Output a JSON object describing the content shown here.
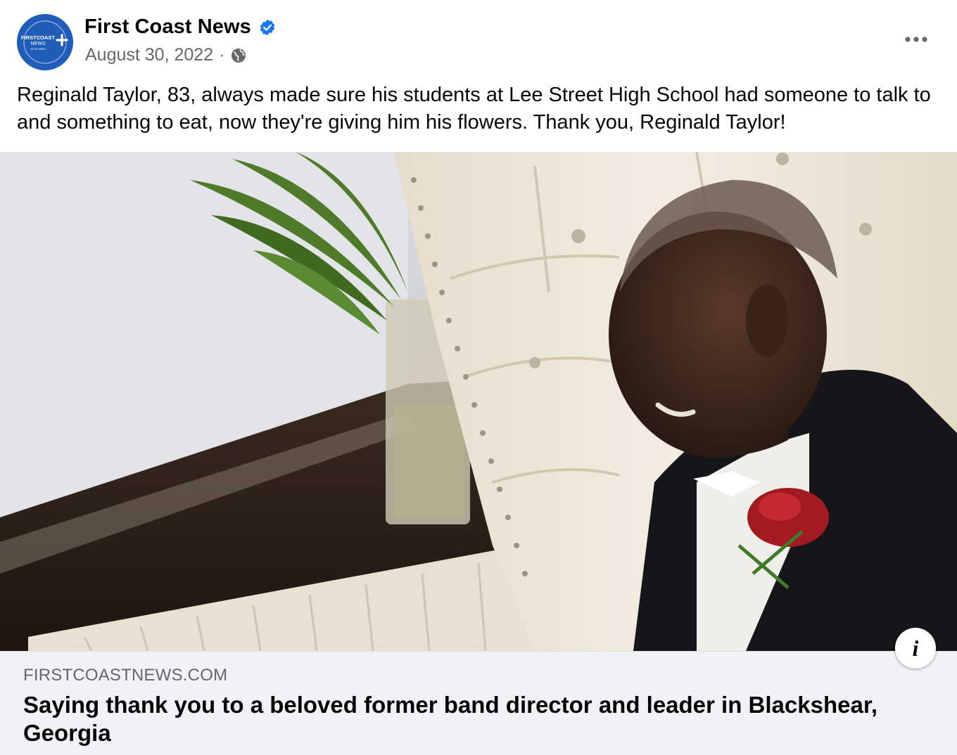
{
  "post": {
    "page_name": "First Coast News",
    "verified": true,
    "date": "August 30, 2022",
    "separator": "·",
    "privacy_icon": "globe-icon",
    "more_icon": "more-options-icon",
    "message": "Reginald Taylor, 83, always made sure his students at Lee Street High School had someone to talk to and something to eat, now they're giving him his flowers. Thank you, Reginald Taylor!"
  },
  "avatar": {
    "logo_line1": "FIRSTCOAST",
    "logo_line2": "NEWS",
    "logo_line3": "YOUR NEWS"
  },
  "link_preview": {
    "domain": "FIRSTCOASTNEWS.COM",
    "title": "Saying thank you to a beloved former band director and leader in Blackshear, Georgia",
    "info_label": "i"
  },
  "colors": {
    "brand_blue": "#1f5db8",
    "verified_blue": "#1877f2",
    "text_primary": "#050505",
    "text_secondary": "#65676b",
    "card_background": "#f0f2f5"
  }
}
